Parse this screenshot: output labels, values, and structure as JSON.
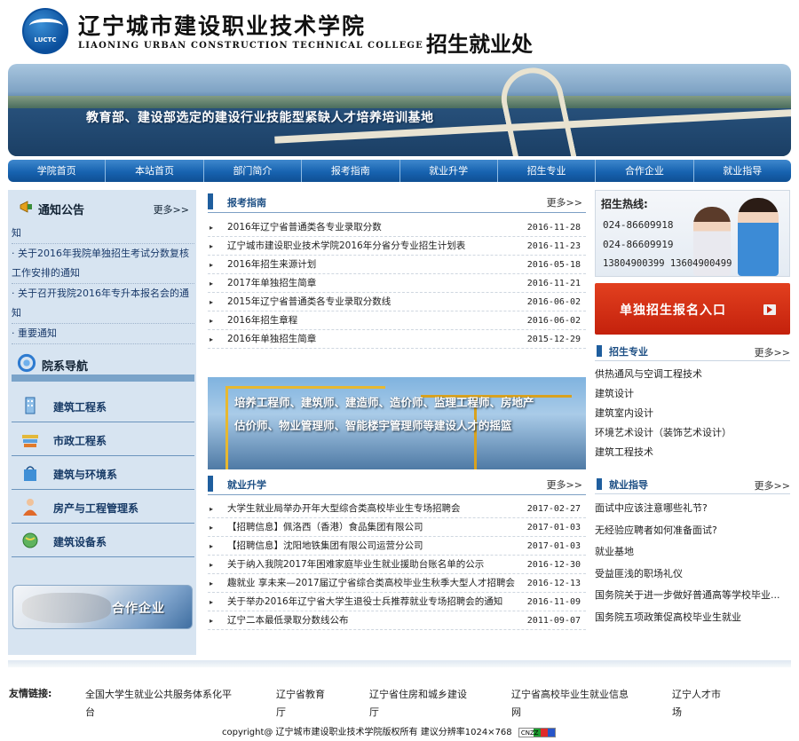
{
  "header": {
    "logo_text": "LUCTC",
    "title_cn": "辽宁城市建设职业技术学院",
    "title_en": "LIAONING URBAN CONSTRUCTION TECHNICAL COLLEGE",
    "dept": "招生就业处"
  },
  "banner": {
    "slogan": "教育部、建设部选定的建设行业技能型紧缺人才培养培训基地"
  },
  "nav": [
    "学院首页",
    "本站首页",
    "部门简介",
    "报考指南",
    "就业升学",
    "招生专业",
    "合作企业",
    "就业指导"
  ],
  "notice": {
    "title": "通知公告",
    "more": "更多>>",
    "items": [
      "知",
      "· 关于2016年我院单独招生考试分数复核工作安排的通知",
      "· 关于召开我院2016年专升本报名会的通知",
      "· 重要通知"
    ]
  },
  "depts": {
    "title": "院系导航",
    "items": [
      "建筑工程系",
      "市政工程系",
      "建筑与环境系",
      "房产与工程管理系",
      "建筑设备系"
    ]
  },
  "coop_label": "合作企业",
  "guide": {
    "title": "报考指南",
    "more": "更多>>",
    "rows": [
      {
        "title": "2016年辽宁省普通类各专业录取分数",
        "date": "2016-11-28"
      },
      {
        "title": "辽宁城市建设职业技术学院2016年分省分专业招生计划表",
        "date": "2016-11-23"
      },
      {
        "title": "2016年招生来源计划",
        "date": "2016-05-18"
      },
      {
        "title": "2017年单独招生简章",
        "date": "2016-11-21"
      },
      {
        "title": "2015年辽宁省普通类各专业录取分数线",
        "date": "2016-06-02"
      },
      {
        "title": "2016年招生章程",
        "date": "2016-06-02"
      },
      {
        "title": "2016年单独招生简章",
        "date": "2015-12-29"
      }
    ]
  },
  "photo_text": "培养工程师、建筑师、建造师、造价师、监理工程师、房地产估价师、物业管理师、智能楼宇管理师等建设人才的摇篮",
  "employ": {
    "title": "就业升学",
    "more": "更多>>",
    "rows": [
      {
        "title": "大学生就业局举办开年大型综合类高校毕业生专场招聘会",
        "date": "2017-02-27"
      },
      {
        "title": "【招聘信息】佩洛西（香港）食品集团有限公司",
        "date": "2017-01-03"
      },
      {
        "title": "【招聘信息】沈阳地铁集团有限公司运营分公司",
        "date": "2017-01-03"
      },
      {
        "title": "关于纳入我院2017年困难家庭毕业生就业援助台账名单的公示",
        "date": "2016-12-30"
      },
      {
        "title": "趣就业 享未来—2017届辽宁省综合类高校毕业生秋季大型人才招聘会",
        "date": "2016-12-13"
      },
      {
        "title": "关于举办2016年辽宁省大学生退役士兵推荐就业专场招聘会的通知",
        "date": "2016-11-09"
      },
      {
        "title": "辽宁二本最低录取分数线公布",
        "date": "2011-09-07"
      }
    ]
  },
  "hotline": {
    "label": "招生热线:",
    "n1": "024-86609918",
    "n2": "024-86609919",
    "n3": "13804900399 13604900499"
  },
  "signup_label": "单独招生报名入口",
  "majors": {
    "title": "招生专业",
    "more": "更多>>",
    "items": [
      "供热通风与空调工程技术",
      "建筑设计",
      "建筑室内设计",
      "环境艺术设计（装饰艺术设计）",
      "建筑工程技术"
    ]
  },
  "career": {
    "title": "就业指导",
    "more": "更多>>",
    "items": [
      "面试中应该注意哪些礼节?",
      "无经验应聘者如何准备面试?",
      "就业基地",
      "受益匪浅的职场礼仪",
      "国务院关于进一步做好普通高等学校毕业...",
      "国务院五项政策促高校毕业生就业"
    ]
  },
  "footer": {
    "links_label": "友情链接:",
    "links": [
      "全国大学生就业公共服务体系化平台",
      "辽宁省教育厅",
      "辽宁省住房和城乡建设厅",
      "辽宁省高校毕业生就业信息网",
      "辽宁人才市场"
    ],
    "copyright": "copyright@ 辽宁城市建设职业技术学院版权所有 建议分辨率1024×768",
    "badge": "CNZZ"
  }
}
